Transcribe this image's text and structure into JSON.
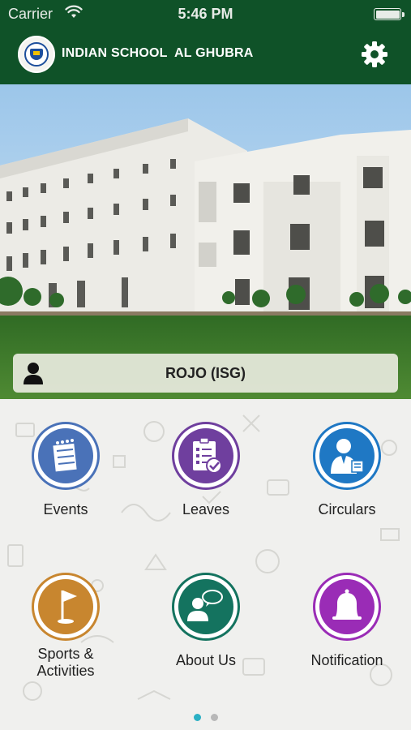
{
  "status_bar": {
    "carrier": "Carrier",
    "time": "5:46 PM"
  },
  "header": {
    "title": "INDIAN SCHOOL  AL GHUBRA",
    "logo_icon": "school-crest-icon",
    "settings_icon": "gear-icon",
    "background_color": "#0f5228"
  },
  "user": {
    "name": "ROJO (ISG)",
    "icon": "person-icon"
  },
  "menu": {
    "items": [
      {
        "label": "Events",
        "icon": "calendar-icon",
        "color": "#4a72b8"
      },
      {
        "label": "Leaves",
        "icon": "clipboard-check-icon",
        "color": "#6f3f9e"
      },
      {
        "label": "Circulars",
        "icon": "speaker-podium-icon",
        "color": "#1f78c4"
      },
      {
        "label": "Sports &\nActivities",
        "icon": "golf-flag-icon",
        "color": "#c8862f"
      },
      {
        "label": "About Us",
        "icon": "chat-person-icon",
        "color": "#14735f"
      },
      {
        "label": "Notification",
        "icon": "bell-icon",
        "color": "#9a2cb6"
      }
    ]
  },
  "pager": {
    "page_count": 2,
    "active_page": 1,
    "active_color": "#2bb0c4",
    "inactive_color": "#b8b8b8"
  }
}
